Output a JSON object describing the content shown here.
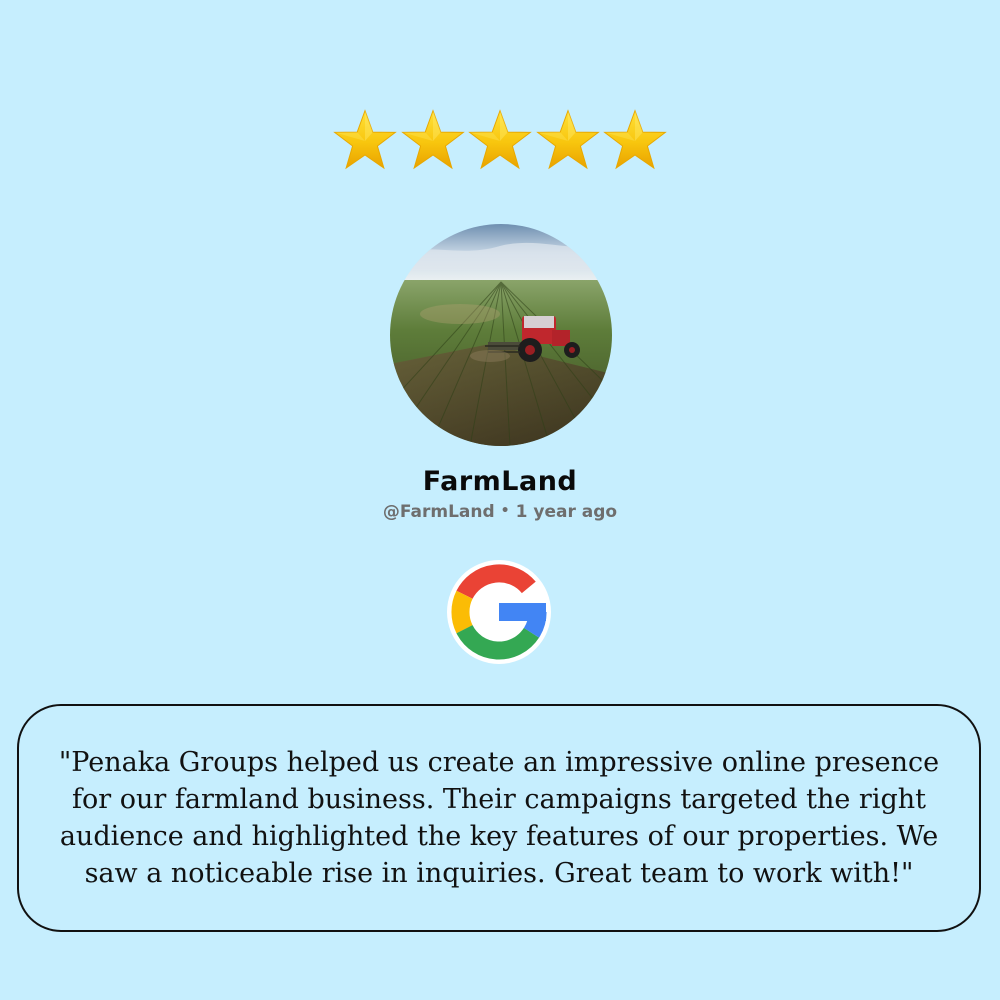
{
  "rating": {
    "value": 5,
    "max": 5,
    "star_color": "#f6c514"
  },
  "reviewer": {
    "name": "FarmLand",
    "handle": "@FarmLand",
    "separator": "•",
    "time_ago": "1 year ago",
    "avatar": "farmland-tractor-photo"
  },
  "platform": {
    "icon": "google-g-logo",
    "name": "Google"
  },
  "review": {
    "lines": [
      "\"Penaka Groups helped us create an impressive online presence",
      "for our farmland business. Their campaigns targeted the right",
      "audience and highlighted the key features of our properties. We",
      "saw a noticeable rise in inquiries. Great team to work with!\""
    ]
  },
  "colors": {
    "background": "#c6eefe",
    "name_text": "#0a0a0a",
    "meta_text": "#6e6e6e",
    "box_border": "#111111"
  }
}
